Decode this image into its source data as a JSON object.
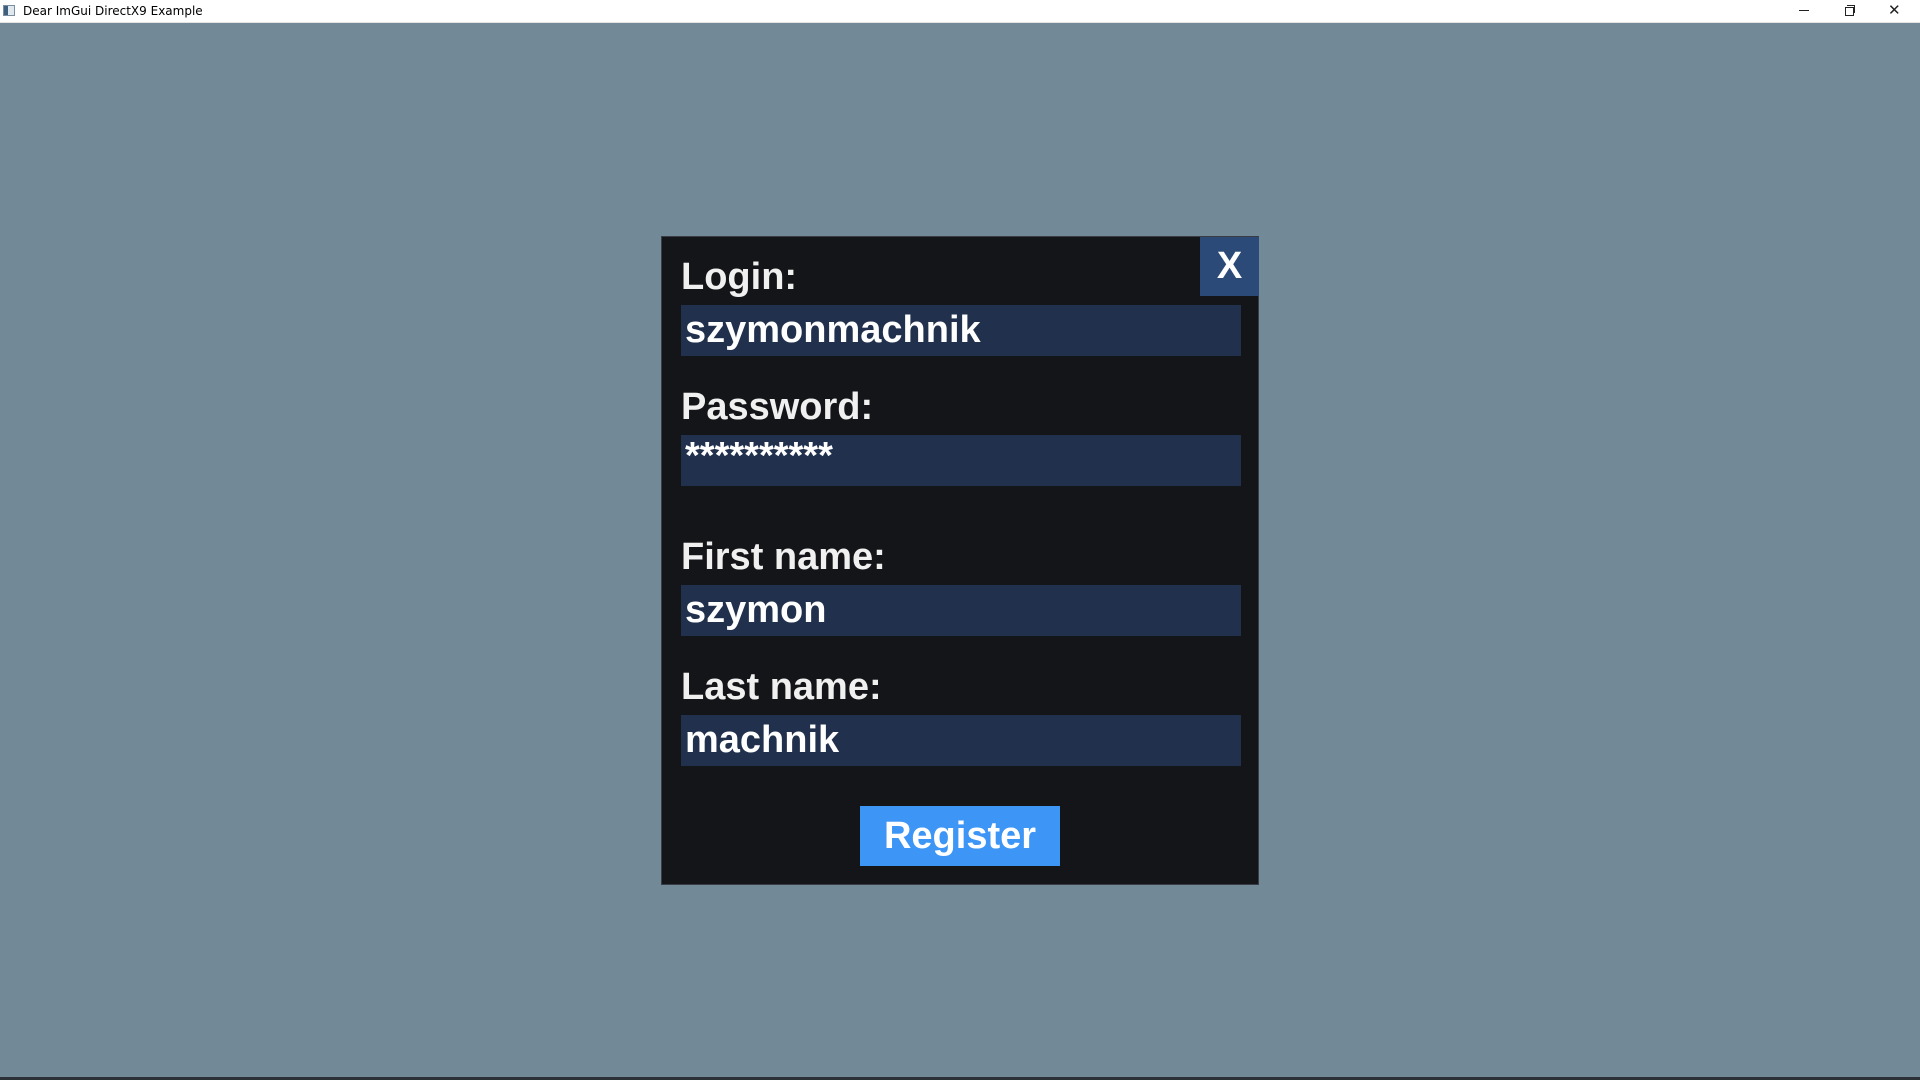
{
  "window": {
    "title": "Dear ImGui DirectX9 Example",
    "controls": {
      "minimize_icon": "minimize-icon",
      "maximize_icon": "restore-icon",
      "close_symbol": "✕"
    }
  },
  "dialog": {
    "close_label": "X",
    "fields": {
      "login": {
        "label": "Login:",
        "value": "szymonmachnik"
      },
      "password": {
        "label": "Password:",
        "value": "**********"
      },
      "first_name": {
        "label": "First name:",
        "value": "szymon"
      },
      "last_name": {
        "label": "Last name:",
        "value": "machnik"
      }
    },
    "register_label": "Register"
  },
  "colors": {
    "background": "#728a98",
    "dialog_bg": "#141518",
    "field_bg": "#20304d",
    "close_bg": "#2b4a78",
    "accent": "#3d95f5"
  }
}
